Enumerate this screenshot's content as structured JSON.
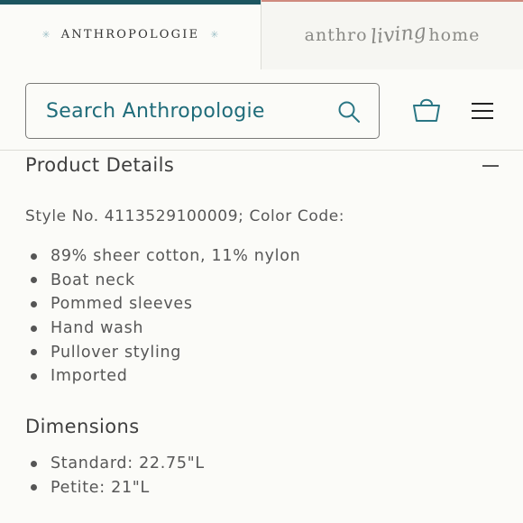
{
  "tabs": {
    "anthropologie_logo": "ANTHROPOLOGIE",
    "living_logo": {
      "prefix": "anthro",
      "script": "living",
      "suffix": "home"
    }
  },
  "header": {
    "search_placeholder": "Search Anthropologie",
    "icons": [
      "search-icon",
      "shopping-bag-icon",
      "hamburger-menu-icon"
    ]
  },
  "product_details": {
    "title": "Product Details",
    "style_line": "Style No. 4113529100009; Color Code:",
    "features": [
      "89% sheer cotton, 11% nylon",
      "Boat neck",
      "Pommed sleeves",
      "Hand wash",
      "Pullover styling",
      "Imported"
    ]
  },
  "dimensions": {
    "title": "Dimensions",
    "items": [
      "Standard: 22.75\"L",
      "Petite: 21\"L"
    ]
  },
  "colors": {
    "accent_teal": "#1c5560",
    "search_text": "#1f6c7a",
    "living_accent": "#cf8a7e"
  }
}
